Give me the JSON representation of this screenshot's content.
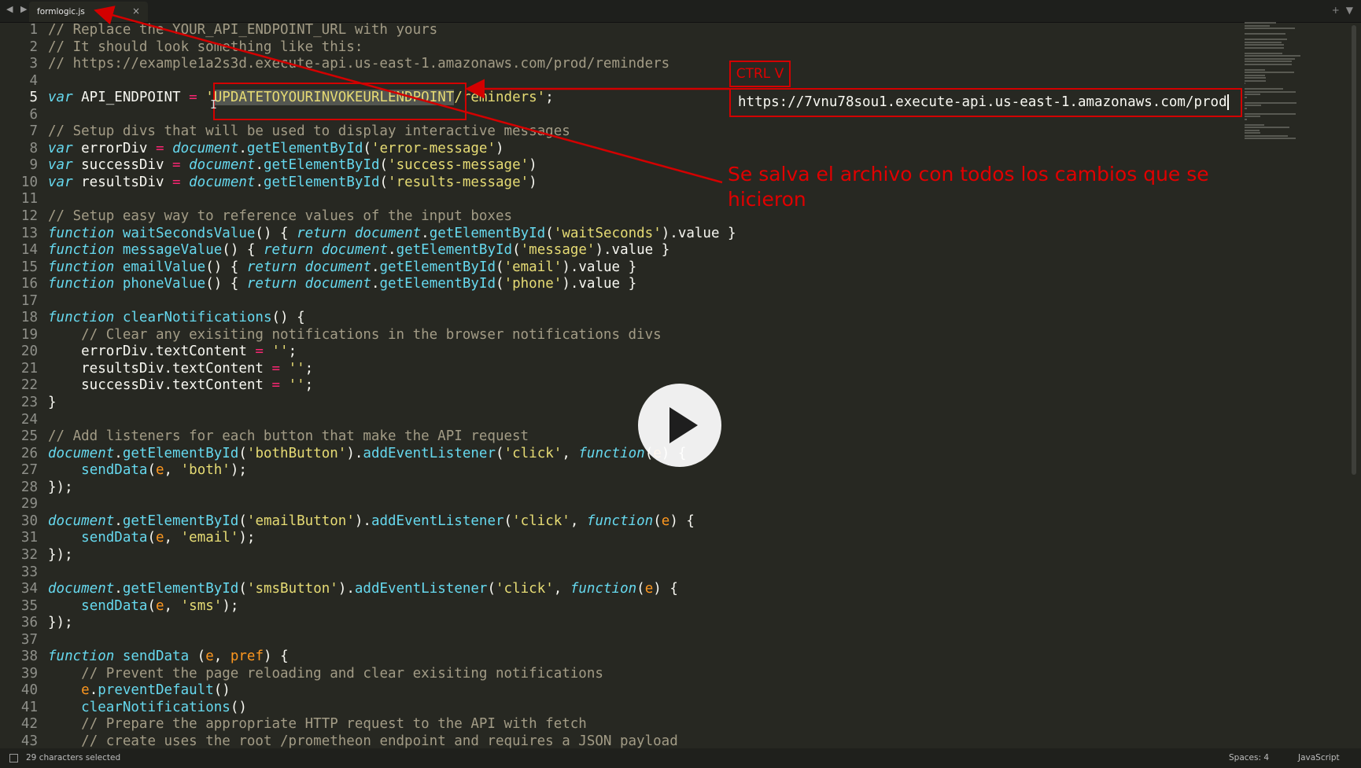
{
  "tab": {
    "filename": "formlogic.js",
    "close_glyph": "×"
  },
  "window_controls": {
    "nav": "◀ ▶",
    "add": "+",
    "menu": "▼"
  },
  "editor": {
    "current_line": 5,
    "line_numbers": [
      "1",
      "2",
      "3",
      "4",
      "5",
      "6",
      "7",
      "8",
      "9",
      "10",
      "11",
      "12",
      "13",
      "14",
      "15",
      "16",
      "17",
      "18",
      "19",
      "20",
      "21",
      "22",
      "23",
      "24",
      "25",
      "26",
      "27",
      "28",
      "29",
      "30",
      "31",
      "32",
      "33",
      "34",
      "35",
      "36",
      "37",
      "38",
      "39",
      "40",
      "41",
      "42",
      "43"
    ],
    "lines": [
      "// Replace the YOUR_API_ENDPOINT_URL with yours",
      "// It should look something like this:",
      "// https://example1a2s3d.execute-api.us-east-1.amazonaws.com/prod/reminders",
      "",
      "var API_ENDPOINT = 'UPDATETOYOURINVOKEURLENDPOINT/reminders';",
      "",
      "// Setup divs that will be used to display interactive messages",
      "var errorDiv = document.getElementById('error-message')",
      "var successDiv = document.getElementById('success-message')",
      "var resultsDiv = document.getElementById('results-message')",
      "",
      "// Setup easy way to reference values of the input boxes",
      "function waitSecondsValue() { return document.getElementById('waitSeconds').value }",
      "function messageValue() { return document.getElementById('message').value }",
      "function emailValue() { return document.getElementById('email').value }",
      "function phoneValue() { return document.getElementById('phone').value }",
      "",
      "function clearNotifications() {",
      "    // Clear any exisiting notifications in the browser notifications divs",
      "    errorDiv.textContent = '';",
      "    resultsDiv.textContent = '';",
      "    successDiv.textContent = '';",
      "}",
      "",
      "// Add listeners for each button that make the API request",
      "document.getElementById('bothButton').addEventListener('click', function(e) {",
      "    sendData(e, 'both');",
      "});",
      "",
      "document.getElementById('emailButton').addEventListener('click', function(e) {",
      "    sendData(e, 'email');",
      "});",
      "",
      "document.getElementById('smsButton').addEventListener('click', function(e) {",
      "    sendData(e, 'sms');",
      "});",
      "",
      "function sendData (e, pref) {",
      "    // Prevent the page reloading and clear exisiting notifications",
      "    e.preventDefault()",
      "    clearNotifications()",
      "    // Prepare the appropriate HTTP request to the API with fetch",
      "    // create uses the root /prometheon endpoint and requires a JSON payload"
    ],
    "selected_text": "UPDATETOYOURINVOKEURLENDPOINT"
  },
  "annotations": {
    "ctrl_v_label": "CTRL V",
    "pasted_url": "https://7vnu78sou1.execute-api.us-east-1.amazonaws.com/prod",
    "note": "Se salva el archivo con todos los cambios que se hicieron",
    "color": "#d30000"
  },
  "video": {
    "control": "play-icon"
  },
  "status_bar": {
    "selection": "29 characters selected",
    "indent": "Spaces: 4",
    "syntax": "JavaScript"
  },
  "theme": {
    "background": "#272822",
    "comment": "#a39c86",
    "keyword": "#66d9ef",
    "string": "#e6db74",
    "param": "#fd971f"
  }
}
